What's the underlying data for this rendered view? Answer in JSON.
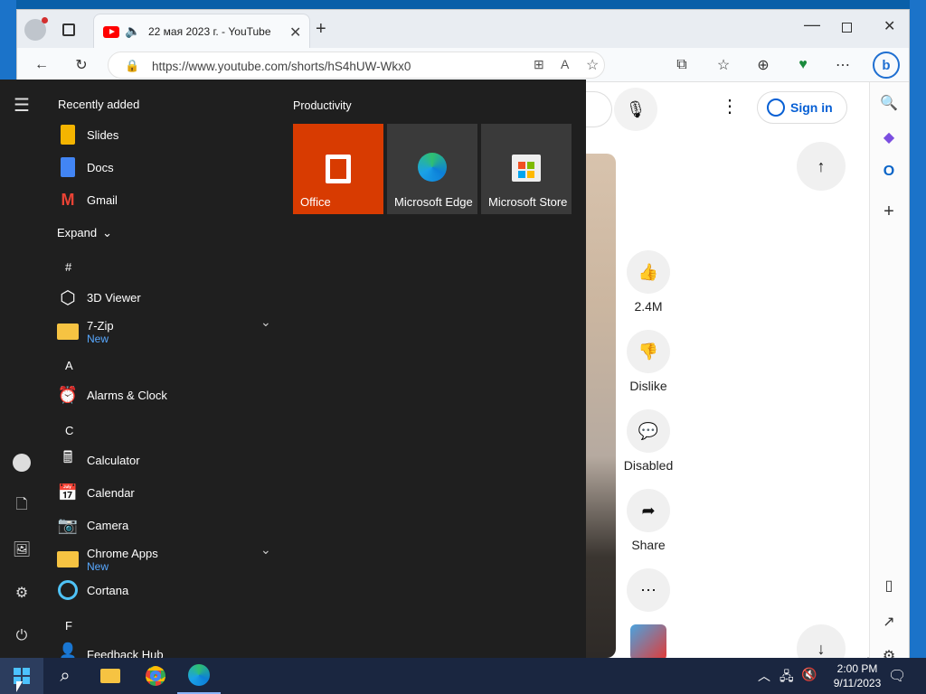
{
  "browser": {
    "tab_title": "22 мая 2023 г. - YouTube",
    "url": "https://www.youtube.com/shorts/hS4hUW-Wkx0"
  },
  "youtube": {
    "signin_label": "Sign in",
    "like_count": "2.4M",
    "dislike_label": "Dislike",
    "comments_label": "Disabled",
    "share_label": "Share"
  },
  "start_menu": {
    "recently_added_heading": "Recently added",
    "recent_items": [
      "Slides",
      "Docs",
      "Gmail"
    ],
    "expand_label": "Expand",
    "sections": {
      "hash": "#",
      "a": "A",
      "c": "C",
      "f": "F"
    },
    "apps": {
      "viewer_3d": "3D Viewer",
      "zip": "7-Zip",
      "zip_badge": "New",
      "alarms": "Alarms & Clock",
      "calculator": "Calculator",
      "calendar": "Calendar",
      "camera": "Camera",
      "chrome_apps": "Chrome Apps",
      "chrome_apps_badge": "New",
      "cortana": "Cortana",
      "feedback": "Feedback Hub"
    },
    "productivity_heading": "Productivity",
    "tiles": {
      "office": "Office",
      "edge": "Microsoft Edge",
      "store": "Microsoft Store"
    }
  },
  "taskbar": {
    "time": "2:00 PM",
    "date": "9/11/2023"
  },
  "colors": {
    "office_tile": "#d83b01",
    "tile_bg": "#3a3a3a",
    "start_bg": "#1f1f1f",
    "taskbar_bg": "#1a2640",
    "accent_link": "#065fd4"
  }
}
